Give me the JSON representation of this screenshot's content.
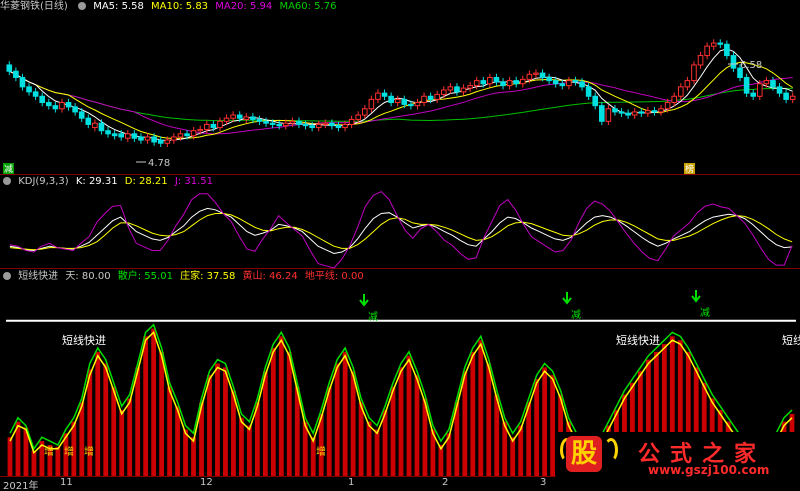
{
  "header_main": {
    "stock_name": "华菱钢铁(日线)",
    "ma5": "MA5: 5.58",
    "ma10": "MA10: 5.83",
    "ma20": "MA20: 5.94",
    "ma60": "MA60: 5.76"
  },
  "header_kdj": {
    "title": "KDJ(9,3,3)",
    "k": "K: 29.31",
    "d": "D: 28.21",
    "j": "J: 31.51"
  },
  "header_short": {
    "title": "短线快进",
    "tian": "天: 80.00",
    "sanhu": "散户: 55.01",
    "zhuangjia": "庄家: 37.58",
    "huangshan": "黄山: 46.24",
    "dipingxian": "地平线: 0.00"
  },
  "annotations": {
    "high": "6.58",
    "low": "4.78",
    "jian": "减",
    "bang": "榜",
    "short_label": "短线快进",
    "sell": "减",
    "buy": "增"
  },
  "x_axis": [
    "2021年",
    "11",
    "12",
    "1",
    "2",
    "3"
  ],
  "watermark": {
    "gu": "股",
    "title": "公式之家",
    "url": "www.gszj100.com"
  },
  "colors": {
    "up": "#ff3030",
    "down": "#00e0e0",
    "ma5": "#ffffff",
    "ma10": "#ffff00",
    "ma20": "#c000c0",
    "ma60": "#00c000",
    "bars": "#cc0000"
  },
  "chart_data": [
    {
      "type": "candlestick",
      "title": "华菱钢铁(日线)",
      "ylim": [
        4.5,
        6.8
      ],
      "x": [
        "2021-10-08",
        "2021-10-11",
        "2021-10-12",
        "2021-10-13",
        "2021-10-14",
        "2021-10-15",
        "2021-10-18",
        "2021-10-19",
        "2021-10-20",
        "2021-10-21",
        "2021-10-22",
        "2021-10-25",
        "2021-10-26",
        "2021-10-27",
        "2021-10-28",
        "2021-10-29",
        "2021-11-01",
        "2021-11-02",
        "2021-11-03",
        "2021-11-04",
        "2021-11-05",
        "2021-11-08",
        "2021-11-09",
        "2021-11-10",
        "2021-11-11",
        "2021-11-12",
        "2021-11-15",
        "2021-11-16",
        "2021-11-17",
        "2021-11-18",
        "2021-11-19",
        "2021-11-22",
        "2021-11-23",
        "2021-11-24",
        "2021-11-25",
        "2021-11-26",
        "2021-11-29",
        "2021-11-30",
        "2021-12-01",
        "2021-12-02",
        "2021-12-03",
        "2021-12-06",
        "2021-12-07",
        "2021-12-08",
        "2021-12-09",
        "2021-12-10",
        "2021-12-13",
        "2021-12-14",
        "2021-12-15",
        "2021-12-16",
        "2021-12-17",
        "2021-12-20",
        "2021-12-21",
        "2021-12-22",
        "2021-12-23",
        "2021-12-24",
        "2021-12-27",
        "2021-12-28",
        "2021-12-29",
        "2021-12-30",
        "2021-12-31",
        "2022-01-04",
        "2022-01-05",
        "2022-01-06",
        "2022-01-07",
        "2022-01-10",
        "2022-01-11",
        "2022-01-12",
        "2022-01-13",
        "2022-01-14",
        "2022-01-17",
        "2022-01-18",
        "2022-01-19",
        "2022-01-20",
        "2022-01-21",
        "2022-01-24",
        "2022-01-25",
        "2022-01-26",
        "2022-01-27",
        "2022-01-28",
        "2022-02-07",
        "2022-02-08",
        "2022-02-09",
        "2022-02-10",
        "2022-02-11",
        "2022-02-14",
        "2022-02-15",
        "2022-02-16",
        "2022-02-17",
        "2022-02-18",
        "2022-02-21",
        "2022-02-22",
        "2022-02-23",
        "2022-02-24",
        "2022-02-25",
        "2022-02-28",
        "2022-03-01",
        "2022-03-02",
        "2022-03-03",
        "2022-03-04",
        "2022-03-07",
        "2022-03-08",
        "2022-03-09",
        "2022-03-10",
        "2022-03-11",
        "2022-03-14",
        "2022-03-15",
        "2022-03-16",
        "2022-03-17",
        "2022-03-18",
        "2022-03-21",
        "2022-03-22",
        "2022-03-23",
        "2022-03-24",
        "2022-03-25",
        "2022-03-28",
        "2022-03-29",
        "2022-03-30",
        "2022-03-31",
        "2022-04-01"
      ],
      "close": [
        5.95,
        5.85,
        5.7,
        5.62,
        5.55,
        5.45,
        5.4,
        5.35,
        5.45,
        5.38,
        5.3,
        5.2,
        5.1,
        5.12,
        5.0,
        4.95,
        4.92,
        4.9,
        4.95,
        4.88,
        4.85,
        4.9,
        4.82,
        4.8,
        4.85,
        4.9,
        4.95,
        4.92,
        5.0,
        5.02,
        5.1,
        5.05,
        5.15,
        5.2,
        5.25,
        5.2,
        5.22,
        5.18,
        5.15,
        5.12,
        5.1,
        5.08,
        5.12,
        5.15,
        5.1,
        5.08,
        5.05,
        5.1,
        5.12,
        5.08,
        5.05,
        5.1,
        5.18,
        5.25,
        5.35,
        5.5,
        5.6,
        5.55,
        5.45,
        5.5,
        5.42,
        5.4,
        5.45,
        5.55,
        5.5,
        5.58,
        5.65,
        5.7,
        5.62,
        5.68,
        5.72,
        5.8,
        5.75,
        5.85,
        5.78,
        5.72,
        5.8,
        5.75,
        5.82,
        5.9,
        5.92,
        5.85,
        5.8,
        5.75,
        5.72,
        5.8,
        5.78,
        5.7,
        5.55,
        5.4,
        5.15,
        5.35,
        5.3,
        5.28,
        5.25,
        5.3,
        5.28,
        5.32,
        5.3,
        5.35,
        5.45,
        5.55,
        5.7,
        5.8,
        6.05,
        6.2,
        6.35,
        6.4,
        6.38,
        6.2,
        6.0,
        5.85,
        5.6,
        5.55,
        5.75,
        5.8,
        5.7,
        5.6,
        5.5,
        5.55
      ],
      "open": [
        6.05,
        5.95,
        5.85,
        5.7,
        5.62,
        5.55,
        5.45,
        5.4,
        5.35,
        5.45,
        5.38,
        5.3,
        5.2,
        5.05,
        5.12,
        5.0,
        4.95,
        4.95,
        4.88,
        4.95,
        4.9,
        4.85,
        4.9,
        4.85,
        4.8,
        4.85,
        4.9,
        4.95,
        4.92,
        5.0,
        5.02,
        5.1,
        5.05,
        5.15,
        5.2,
        5.25,
        5.18,
        5.22,
        5.18,
        5.15,
        5.12,
        5.1,
        5.08,
        5.12,
        5.15,
        5.1,
        5.08,
        5.05,
        5.1,
        5.12,
        5.08,
        5.05,
        5.1,
        5.18,
        5.25,
        5.35,
        5.5,
        5.6,
        5.55,
        5.45,
        5.5,
        5.42,
        5.4,
        5.45,
        5.55,
        5.5,
        5.58,
        5.65,
        5.7,
        5.62,
        5.68,
        5.72,
        5.8,
        5.75,
        5.85,
        5.78,
        5.72,
        5.8,
        5.75,
        5.82,
        5.9,
        5.92,
        5.85,
        5.8,
        5.75,
        5.72,
        5.8,
        5.78,
        5.7,
        5.55,
        5.4,
        5.15,
        5.35,
        5.3,
        5.28,
        5.25,
        5.3,
        5.28,
        5.32,
        5.3,
        5.35,
        5.45,
        5.55,
        5.7,
        5.8,
        6.05,
        6.2,
        6.35,
        6.4,
        6.38,
        6.2,
        6.0,
        5.85,
        5.6,
        5.55,
        5.75,
        5.8,
        5.7,
        5.6,
        5.5
      ]
    },
    {
      "type": "line",
      "title": "KDJ(9,3,3)",
      "series": [
        {
          "name": "K",
          "values": [
            30,
            28,
            25,
            24,
            27,
            30,
            28,
            27,
            26,
            30,
            35,
            45,
            55,
            65,
            70,
            60,
            50,
            45,
            40,
            38,
            42,
            50,
            58,
            70,
            78,
            82,
            80,
            75,
            70,
            60,
            50,
            45,
            48,
            52,
            60,
            58,
            55,
            50,
            40,
            30,
            25,
            20,
            22,
            28,
            40,
            55,
            68,
            75,
            76,
            70,
            62,
            55,
            58,
            60,
            56,
            50,
            45,
            38,
            32,
            30,
            40,
            50,
            62,
            70,
            68,
            62,
            55,
            50,
            45,
            40,
            38,
            42,
            52,
            62,
            70,
            72,
            70,
            65,
            58,
            50,
            42,
            35,
            30,
            34,
            40,
            45,
            50,
            58,
            65,
            70,
            72,
            74,
            72,
            68,
            60,
            50,
            40,
            32,
            28,
            29
          ]
        },
        {
          "name": "D",
          "values": [
            28,
            27,
            26,
            25,
            26,
            28,
            28,
            27,
            27,
            28,
            31,
            36,
            45,
            55,
            62,
            62,
            58,
            53,
            48,
            45,
            44,
            46,
            50,
            58,
            66,
            72,
            75,
            75,
            73,
            68,
            62,
            56,
            52,
            51,
            54,
            56,
            56,
            53,
            48,
            42,
            36,
            30,
            27,
            27,
            32,
            40,
            50,
            60,
            67,
            69,
            67,
            62,
            60,
            60,
            59,
            56,
            52,
            47,
            42,
            38,
            39,
            43,
            50,
            58,
            62,
            63,
            61,
            57,
            53,
            49,
            45,
            44,
            47,
            52,
            59,
            64,
            66,
            66,
            63,
            58,
            52,
            46,
            40,
            38,
            38,
            41,
            44,
            49,
            55,
            61,
            66,
            70,
            72,
            71,
            67,
            61,
            54,
            46,
            40,
            36
          ]
        },
        {
          "name": "J",
          "values": [
            32,
            30,
            24,
            22,
            30,
            34,
            28,
            26,
            24,
            34,
            43,
            63,
            75,
            85,
            86,
            56,
            34,
            29,
            24,
            24,
            38,
            58,
            74,
            94,
            102,
            102,
            90,
            75,
            64,
            44,
            26,
            23,
            40,
            54,
            72,
            62,
            53,
            44,
            24,
            6,
            3,
            0,
            12,
            30,
            56,
            85,
            100,
            105,
            94,
            72,
            52,
            41,
            54,
            60,
            50,
            38,
            31,
            20,
            12,
            14,
            42,
            64,
            86,
            94,
            80,
            60,
            43,
            36,
            29,
            22,
            24,
            38,
            62,
            82,
            92,
            88,
            78,
            63,
            48,
            34,
            22,
            13,
            10,
            26,
            44,
            53,
            62,
            76,
            85,
            88,
            84,
            82,
            72,
            62,
            46,
            28,
            12,
            4,
            4,
            31
          ]
        }
      ]
    },
    {
      "type": "bar",
      "title": "短线快进",
      "ylim": [
        0,
        100
      ],
      "series": [
        {
          "name": "散户",
          "values": [
            22,
            30,
            26,
            14,
            20,
            18,
            16,
            24,
            30,
            40,
            58,
            66,
            60,
            48,
            36,
            42,
            58,
            74,
            78,
            66,
            48,
            38,
            26,
            22,
            40,
            54,
            60,
            58,
            46,
            32,
            28,
            40,
            56,
            68,
            74,
            66,
            48,
            30,
            22,
            34,
            48,
            60,
            66,
            56,
            40,
            30,
            26,
            36,
            48,
            58,
            64,
            54,
            42,
            26,
            18,
            24,
            40,
            56,
            66,
            72,
            60,
            44,
            30,
            22,
            28,
            40,
            52,
            58,
            54,
            44,
            30,
            22,
            16,
            12,
            20,
            28,
            36,
            44,
            50,
            56,
            62,
            66,
            70,
            74,
            72,
            66,
            58,
            50,
            42,
            36,
            30,
            24,
            18,
            14,
            12,
            16,
            22,
            30,
            34
          ]
        },
        {
          "name": "庄家",
          "values": [
            18,
            26,
            24,
            12,
            16,
            14,
            14,
            20,
            26,
            36,
            52,
            62,
            56,
            44,
            32,
            38,
            54,
            70,
            74,
            62,
            44,
            34,
            22,
            18,
            36,
            50,
            56,
            54,
            42,
            28,
            24,
            36,
            52,
            64,
            70,
            62,
            44,
            26,
            18,
            30,
            44,
            56,
            62,
            52,
            36,
            26,
            22,
            32,
            44,
            54,
            60,
            50,
            38,
            22,
            14,
            20,
            36,
            52,
            62,
            68,
            56,
            40,
            26,
            18,
            24,
            36,
            48,
            54,
            50,
            40,
            26,
            18,
            12,
            8,
            16,
            24,
            32,
            40,
            46,
            52,
            58,
            62,
            66,
            70,
            68,
            62,
            54,
            46,
            38,
            32,
            26,
            20,
            14,
            10,
            8,
            12,
            18,
            26,
            30
          ]
        },
        {
          "name": "黄山",
          "values": [
            20,
            28,
            25,
            13,
            18,
            16,
            15,
            22,
            28,
            38,
            55,
            64,
            58,
            46,
            34,
            40,
            56,
            72,
            76,
            64,
            46,
            36,
            24,
            20,
            38,
            52,
            58,
            56,
            44,
            30,
            26,
            38,
            54,
            66,
            72,
            64,
            46,
            28,
            20,
            32,
            46,
            58,
            64,
            54,
            38,
            28,
            24,
            34,
            46,
            56,
            62,
            52,
            40,
            24,
            16,
            22,
            38,
            54,
            64,
            70,
            58,
            42,
            28,
            20,
            26,
            38,
            50,
            56,
            52,
            42,
            28,
            20,
            14,
            10,
            18,
            26,
            34,
            42,
            48,
            54,
            60,
            64,
            68,
            72,
            70,
            64,
            56,
            48,
            40,
            34,
            28,
            22,
            16,
            12,
            10,
            14,
            20,
            28,
            32
          ]
        },
        {
          "name": "天",
          "values": [
            80,
            80,
            80,
            80,
            80,
            80,
            80,
            80,
            80,
            80,
            80,
            80,
            80,
            80,
            80,
            80,
            80,
            80,
            80,
            80,
            80,
            80,
            80,
            80,
            80,
            80,
            80,
            80,
            80,
            80,
            80,
            80,
            80,
            80,
            80,
            80,
            80,
            80,
            80,
            80,
            80,
            80,
            80,
            80,
            80,
            80,
            80,
            80,
            80,
            80,
            80,
            80,
            80,
            80,
            80,
            80,
            80,
            80,
            80,
            80,
            80,
            80,
            80,
            80,
            80,
            80,
            80,
            80,
            80,
            80,
            80,
            80,
            80,
            80,
            80,
            80,
            80,
            80,
            80,
            80,
            80,
            80,
            80,
            80,
            80,
            80,
            80,
            80,
            80,
            80,
            80,
            80,
            80,
            80,
            80,
            80,
            80,
            80,
            80
          ]
        }
      ]
    }
  ]
}
